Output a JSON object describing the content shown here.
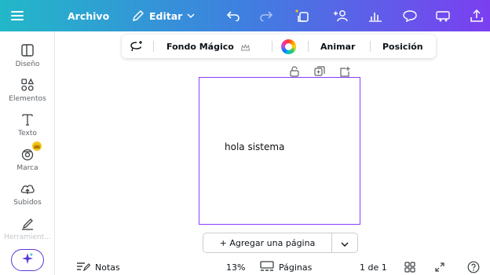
{
  "topbar": {
    "menu_icon": "hamburger-menu-icon",
    "file_label": "Archivo",
    "edit_label": "Editar",
    "edit_icon": "pencil-icon",
    "undo_icon": "undo-icon",
    "redo_icon": "redo-icon",
    "icons": [
      "resize-magic-icon",
      "add-people-icon",
      "insights-chart-icon",
      "comment-bubble-icon",
      "present-icon",
      "share-upload-icon"
    ],
    "colors": {
      "gradient_start": "#22b8c8",
      "gradient_end": "#7b3ff0",
      "crown": "#f5c518"
    }
  },
  "sidebar": {
    "items": [
      {
        "label": "Diseño",
        "icon": "layout-icon"
      },
      {
        "label": "Elementos",
        "icon": "shapes-icon"
      },
      {
        "label": "Texto",
        "icon": "text-icon"
      },
      {
        "label": "Marca",
        "icon": "brand-kit-icon"
      },
      {
        "label": "Subidos",
        "icon": "cloud-upload-icon"
      },
      {
        "label": "Herramient...",
        "icon": "draw-icon"
      }
    ],
    "magic_icon": "magic-sparkle-icon"
  },
  "context_toolbar": {
    "magic_edit_icon": "lasso-magic-icon",
    "background_label": "Fondo Mágico",
    "crown_icon": "crown-icon",
    "color_icon": "color-wheel-icon",
    "animate_label": "Animar",
    "position_label": "Posición"
  },
  "canvas": {
    "page_tools": [
      "lock-icon",
      "duplicate-icon",
      "add-page-icon"
    ],
    "page_text": "hola sistema",
    "add_page_label": "+ Agregar una página",
    "accent": "#8b3dff"
  },
  "bottombar": {
    "notes_label": "Notas",
    "zoom": "13%",
    "pages_label": "Páginas",
    "page_count": "1 de 1",
    "icons": [
      "notes-icon",
      "pages-icon",
      "grid-view-icon",
      "fullscreen-icon",
      "help-icon"
    ]
  }
}
